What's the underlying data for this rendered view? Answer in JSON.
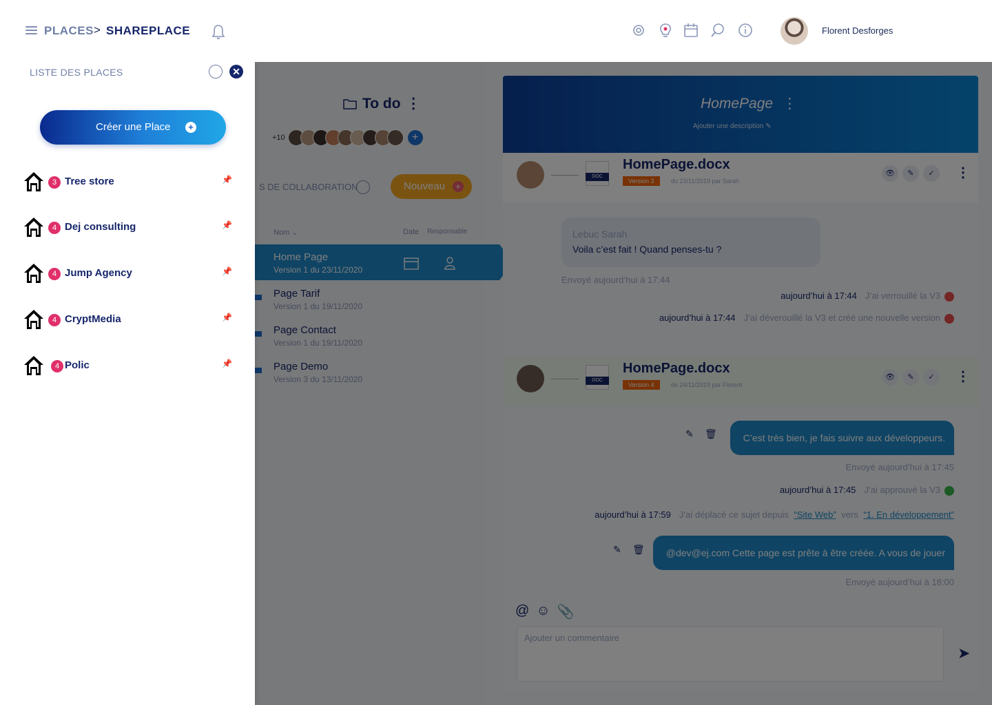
{
  "header": {
    "breadcrumb_root": "PLACES",
    "breadcrumb_separator": ">",
    "breadcrumb_current": "SHAREPLACE",
    "user_name": "Florent Desforges",
    "icons": [
      "menu-icon",
      "bell-icon",
      "settings-icon",
      "idea-icon",
      "calendar-icon",
      "search-icon",
      "info-icon"
    ]
  },
  "sidebar": {
    "title": "LISTE DES PLACES",
    "create_button": "Créer une Place",
    "create_plus": "+",
    "close": "✕",
    "places": [
      {
        "name": "Tree store",
        "count": "3",
        "pin": "📌"
      },
      {
        "name": "Dej consulting",
        "count": "4",
        "pin": "📌"
      },
      {
        "name": "Jump Agency",
        "count": "4",
        "pin": "📌"
      },
      {
        "name": "CryptMedia",
        "count": "4",
        "pin": "📌"
      },
      {
        "name": "Polic",
        "count": "4",
        "pin": "📌"
      }
    ]
  },
  "todo": {
    "title": "To do",
    "more": "⋮",
    "members_extra": "+10",
    "add_member": "+",
    "collab_label": "S DE COLLABORATION",
    "new_button": "Nouveau",
    "new_plus": "+",
    "col_name": "Nom ⌄",
    "col_date": "Date",
    "col_owner": "Responsable",
    "documents": [
      {
        "name": "Home Page",
        "sub": "Version 1 du 23/11/2020"
      },
      {
        "name": "Page Tarif",
        "sub": "Version 1 du 19/11/2020"
      },
      {
        "name": "Page Contact",
        "sub": "Version 1 du 19/11/2020"
      },
      {
        "name": "Page Demo",
        "sub": "Version 3 du 13/11/2020"
      }
    ]
  },
  "detail": {
    "title": "HomePage",
    "more": "⋮",
    "description_placeholder": "Ajouter une description ✎",
    "file1": {
      "name": "HomePage.docx",
      "doc_badge": "DOC",
      "version": "Version 3",
      "date": "du 23/11/2019 par Sarah"
    },
    "file2": {
      "name": "HomePage.docx",
      "doc_badge": "DOC",
      "version": "Version 4",
      "date": "du 24/11/2019 par Florent"
    },
    "file_actions": [
      "👁",
      "✎",
      "✓"
    ],
    "incoming": {
      "author": "Lebuc Sarah",
      "text": "Voila c’est fait ! Quand penses-tu ?",
      "sent": "Envoyé aujourd’hui à 17:44"
    },
    "log1": {
      "time": "aujourd’hui à 17:44",
      "action": "J’ai verrouillé la V3"
    },
    "log2": {
      "time": "aujourd’hui à 17:44",
      "action": "J’ai déverouillé la V3 et créé une nouvelle version"
    },
    "out1": {
      "text": "C’est très bien, je fais suivre aux développeurs.",
      "sent": "Envoyé aujourd’hui à 17:45"
    },
    "log3": {
      "time": "aujourd’hui à 17:45",
      "action": "J’ai approuvé la V3"
    },
    "log4": {
      "time": "aujourd’hui à 17:59",
      "action": "J’ai déplacé ce sujet depuis",
      "from": "“Site Web”",
      "mid": "vers",
      "to": "“1. En développement”"
    },
    "out2": {
      "text": "@dev@ej.com Cette page est prête à être créée. A vous de jouer",
      "sent": "Envoyé aujourd’hui à 18:00"
    },
    "composer_placeholder": "Ajouter un commentaire",
    "composer_icons": [
      "@",
      "☺",
      "📎"
    ],
    "send": "➤"
  }
}
